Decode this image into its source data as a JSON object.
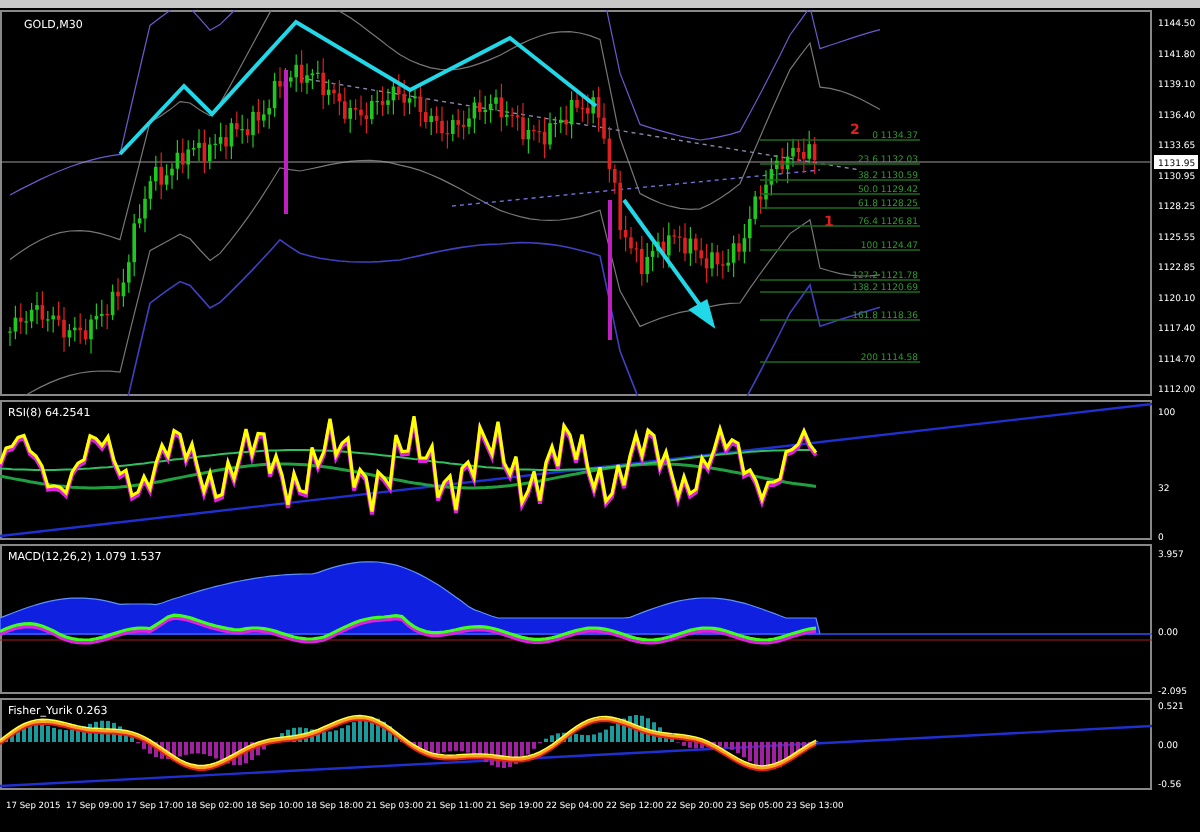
{
  "chart": {
    "symbol_label": "GOLD,M30",
    "price_axis": [
      "1144.50",
      "1141.80",
      "1139.10",
      "1136.40",
      "1133.65",
      "1130.95",
      "1128.25",
      "1125.55",
      "1122.85",
      "1120.10",
      "1117.40",
      "1114.70",
      "1112.00"
    ],
    "current_price": "1131.95",
    "fib_levels": [
      {
        "label": "0 1134.37"
      },
      {
        "label": "23.6 1132.03"
      },
      {
        "label": "38.2 1130.59"
      },
      {
        "label": "50.0 1129.42"
      },
      {
        "label": "61.8 1128.25"
      },
      {
        "label": "76.4 1126.81"
      },
      {
        "label": "100 1124.47"
      },
      {
        "label": "127.2 1121.78"
      },
      {
        "label": "138.2 1120.69"
      },
      {
        "label": "161.8 1118.36"
      },
      {
        "label": "200 1114.58"
      }
    ],
    "wave_marks": [
      "2",
      "1"
    ]
  },
  "indicators": [
    {
      "kind": "rsi",
      "title": "RSI(8) 64.2541",
      "axis": [
        "100",
        "32",
        "0"
      ]
    },
    {
      "kind": "macd",
      "title": "MACD(12,26,2) 1.079 1.537",
      "axis": [
        "3.957",
        "0.00",
        "-2.095"
      ]
    },
    {
      "kind": "fisher",
      "title": "Fisher_Yurik 0.263",
      "axis": [
        "0.521",
        "0.00",
        "-0.56"
      ]
    }
  ],
  "time_axis": [
    "17 Sep 2015",
    "17 Sep 09:00",
    "17 Sep 17:00",
    "18 Sep 02:00",
    "18 Sep 10:00",
    "18 Sep 18:00",
    "21 Sep 03:00",
    "21 Sep 11:00",
    "21 Sep 19:00",
    "22 Sep 04:00",
    "22 Sep 12:00",
    "22 Sep 20:00",
    "23 Sep 05:00",
    "23 Sep 13:00"
  ]
}
